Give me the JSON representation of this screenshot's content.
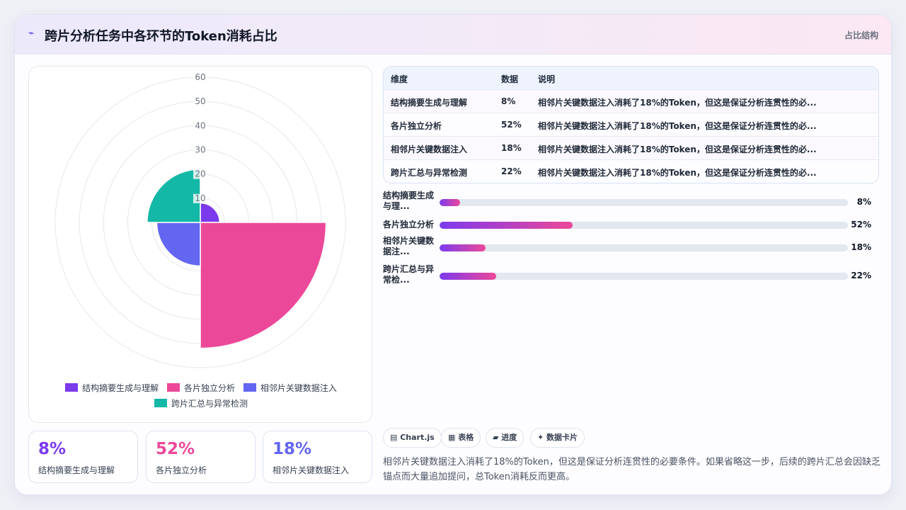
{
  "header": {
    "icon": "trend-icon",
    "title": "跨片分析任务中各环节的Token消耗占比",
    "tag": "占比结构"
  },
  "colors": {
    "purple": "#7c3aed",
    "pink": "#ec4899",
    "indigo": "#6366f1",
    "teal": "#14b8a6"
  },
  "chart_data": {
    "type": "polarArea",
    "title": "",
    "categories": [
      "结构摘要生成与理解",
      "各片独立分析",
      "相邻片关键数据注入",
      "跨片汇总与异常检测"
    ],
    "values": [
      8,
      52,
      18,
      22
    ],
    "colors": [
      "#7c3aed",
      "#ec4899",
      "#6366f1",
      "#14b8a6"
    ],
    "r_ticks": [
      "10",
      "20",
      "30",
      "40",
      "50",
      "60"
    ],
    "rlim": [
      0,
      60
    ],
    "grid": true,
    "legend_position": "bottom"
  },
  "table": {
    "headers": [
      "维度",
      "数据",
      "说明"
    ],
    "rows": [
      [
        "结构摘要生成与理解",
        "8%",
        "相邻片关键数据注入消耗了18%的Token，但这是保证分析连贯性的必..."
      ],
      [
        "各片独立分析",
        "52%",
        "相邻片关键数据注入消耗了18%的Token，但这是保证分析连贯性的必..."
      ],
      [
        "相邻片关键数据注入",
        "18%",
        "相邻片关键数据注入消耗了18%的Token，但这是保证分析连贯性的必..."
      ],
      [
        "跨片汇总与异常检测",
        "22%",
        "相邻片关键数据注入消耗了18%的Token，但这是保证分析连贯性的必..."
      ]
    ]
  },
  "progress": [
    {
      "label": "结构摘要生成与理...",
      "value_text": "8%",
      "fraction": 0.05
    },
    {
      "label": "各片独立分析",
      "value_text": "52%",
      "fraction": 0.325
    },
    {
      "label": "相邻片关键数据注...",
      "value_text": "18%",
      "fraction": 0.113
    },
    {
      "label": "跨片汇总与异常检...",
      "value_text": "22%",
      "fraction": 0.138
    }
  ],
  "stats": [
    {
      "value": "8%",
      "label": "结构摘要生成与理解",
      "color": "#7c3aed"
    },
    {
      "value": "52%",
      "label": "各片独立分析",
      "color": "#ec4899"
    },
    {
      "value": "18%",
      "label": "相邻片关键数据注入",
      "color": "#6366f1"
    }
  ],
  "chips": [
    "▤ Chart.js",
    "▦ 表格",
    "▰ 进度",
    "✦ 数据卡片"
  ],
  "note": "相邻片关键数据注入消耗了18%的Token，但这是保证分析连贯性的必要条件。如果省略这一步，后续的跨片汇总会因缺乏锚点而大量追加提问，总Token消耗反而更高。"
}
